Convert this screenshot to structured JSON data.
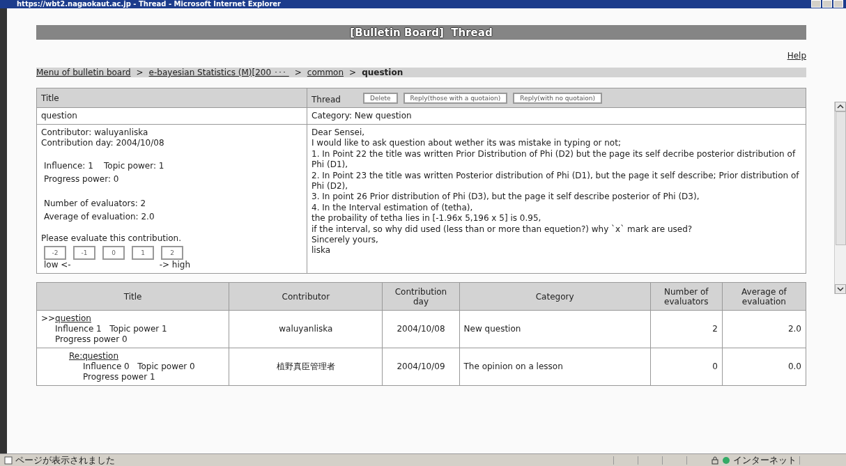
{
  "window": {
    "title": "https://wbt2.nagaokaut.ac.jp - Thread - Microsoft Internet Explorer"
  },
  "header": {
    "title": "[Bulletin Board]  Thread"
  },
  "help_link": "Help",
  "breadcrumb": [
    {
      "kind": "link",
      "label": "Menu of bulletin board"
    },
    {
      "kind": "link",
      "label": "e-bayesian Statistics (M)[200 ･･･ "
    },
    {
      "kind": "link",
      "label": "common"
    },
    {
      "kind": "current",
      "label": "question"
    }
  ],
  "breadcrumb_separator": ">",
  "post": {
    "title_heading": "Title",
    "thread_heading": "Thread",
    "buttons": [
      "Delete",
      "Reply(those with a quotaion)",
      "Reply(with no quotaion)"
    ],
    "title": "question",
    "category": "Category:  New question",
    "contributor": "Contributor: waluyanliska",
    "day": "Contribution day: 2004/10/08",
    "influence": "Influence: 1",
    "topic_power": "Topic power: 1",
    "progress_power": "Progress power: 0",
    "evaluators": "Number of evaluators: 2",
    "average": "Average of evaluation: 2.0",
    "evaluate_prompt": "Please evaluate this contribution.",
    "rating_buttons": [
      "-2",
      "-1",
      "0",
      "1",
      "2"
    ],
    "scale_low": "low <-",
    "scale_high": "-> high",
    "message": [
      "Dear Sensei,",
      "I would like to ask question about wether its was mistake in typing or not;",
      "1. In Point 22 the title was written Prior Distribution of Phi (D2) but the page its self decribe posterior distribution of Phi (D1),",
      "2. In Point 23 the title was written Posterior distribution of Phi (D1), but the page it self describe; Prior distribution of Phi (D2),",
      "3. In point 26 Prior distribution of Phi (D3), but the page it self describe posterior of Phi (D3),",
      "4. In the Interval estimation of (tetha),",
      "the probaility of tetha lies in [-1.96x 5,196 x 5] is 0.95,",
      "if the interval, so why did used (less than or more than equetion?) why `x` mark are used?",
      "Sincerely yours,",
      "liska"
    ]
  },
  "thread_table": {
    "columns": [
      "Title",
      "Contributor",
      "Contribution day",
      "Category",
      "Number of evaluators",
      "Average of evaluation"
    ],
    "rows": [
      {
        "marker": ">>",
        "title": "question",
        "influence": "Influence 1",
        "topic_power": "Topic power 1",
        "progress_power": "Progress power 0",
        "contributor": "waluyanliska",
        "day": "2004/10/08",
        "category": "New question",
        "evaluators": "2",
        "average": "2.0",
        "children": [
          {
            "title": "Re:question",
            "influence": "Influence 0",
            "topic_power": "Topic power 0",
            "progress_power": "Progress power 1",
            "contributor": "植野真臣管理者",
            "day": "2004/10/09",
            "category": "The opinion on a lesson",
            "evaluators": "0",
            "average": "0.0"
          }
        ]
      }
    ]
  },
  "status_bar": {
    "text": "ページが表示されました",
    "zone": "インターネット"
  }
}
